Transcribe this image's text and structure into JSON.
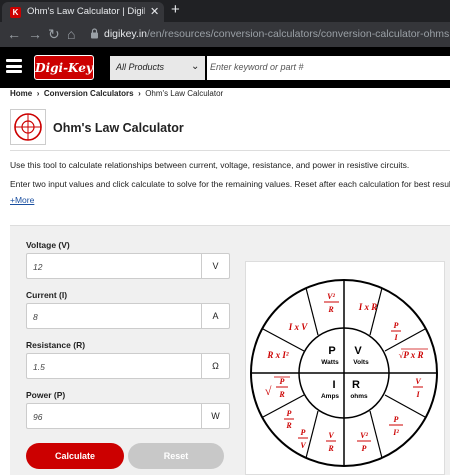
{
  "browser": {
    "tab_title": "Ohm's Law Calculator | DigiKey E",
    "tab_close": "✕",
    "new_tab": "+",
    "url_domain": "digikey.in",
    "url_path": "/en/resources/conversion-calculators/conversion-calculator-ohms"
  },
  "header": {
    "logo_text": "Digi-Key",
    "category_select": "All Products",
    "search_placeholder": "Enter keyword or part #"
  },
  "breadcrumb": [
    "Home",
    "Conversion Calculators",
    "Ohm's Law Calculator"
  ],
  "page": {
    "title": "Ohm's Law Calculator",
    "description_1": "Use this tool to calculate relationships between current, voltage, resistance, and power in resistive circuits.",
    "description_2": "Enter two input values and click calculate to solve for the remaining values. Reset after each calculation for best results.",
    "more_link": "+More"
  },
  "calculator": {
    "fields": [
      {
        "label": "Voltage (V)",
        "value": "12",
        "unit": "V"
      },
      {
        "label": "Current (I)",
        "value": "8",
        "unit": "A"
      },
      {
        "label": "Resistance (R)",
        "value": "1.5",
        "unit": "Ω"
      },
      {
        "label": "Power (P)",
        "value": "96",
        "unit": "W"
      }
    ],
    "calculate_label": "Calculate",
    "reset_label": "Reset"
  },
  "wheel": {
    "center": [
      {
        "letter": "P",
        "unit": "Watts"
      },
      {
        "letter": "V",
        "unit": "Volts"
      },
      {
        "letter": "I",
        "unit": "Amps"
      },
      {
        "letter": "R",
        "unit": "ohms"
      }
    ],
    "formulas": {
      "p_from_ri": "R x I²",
      "p_from_vi": "I x V",
      "v_from_ir": "I x R",
      "r_from_p_i_label_I": "I"
    },
    "accent_color": "#cc0000"
  }
}
